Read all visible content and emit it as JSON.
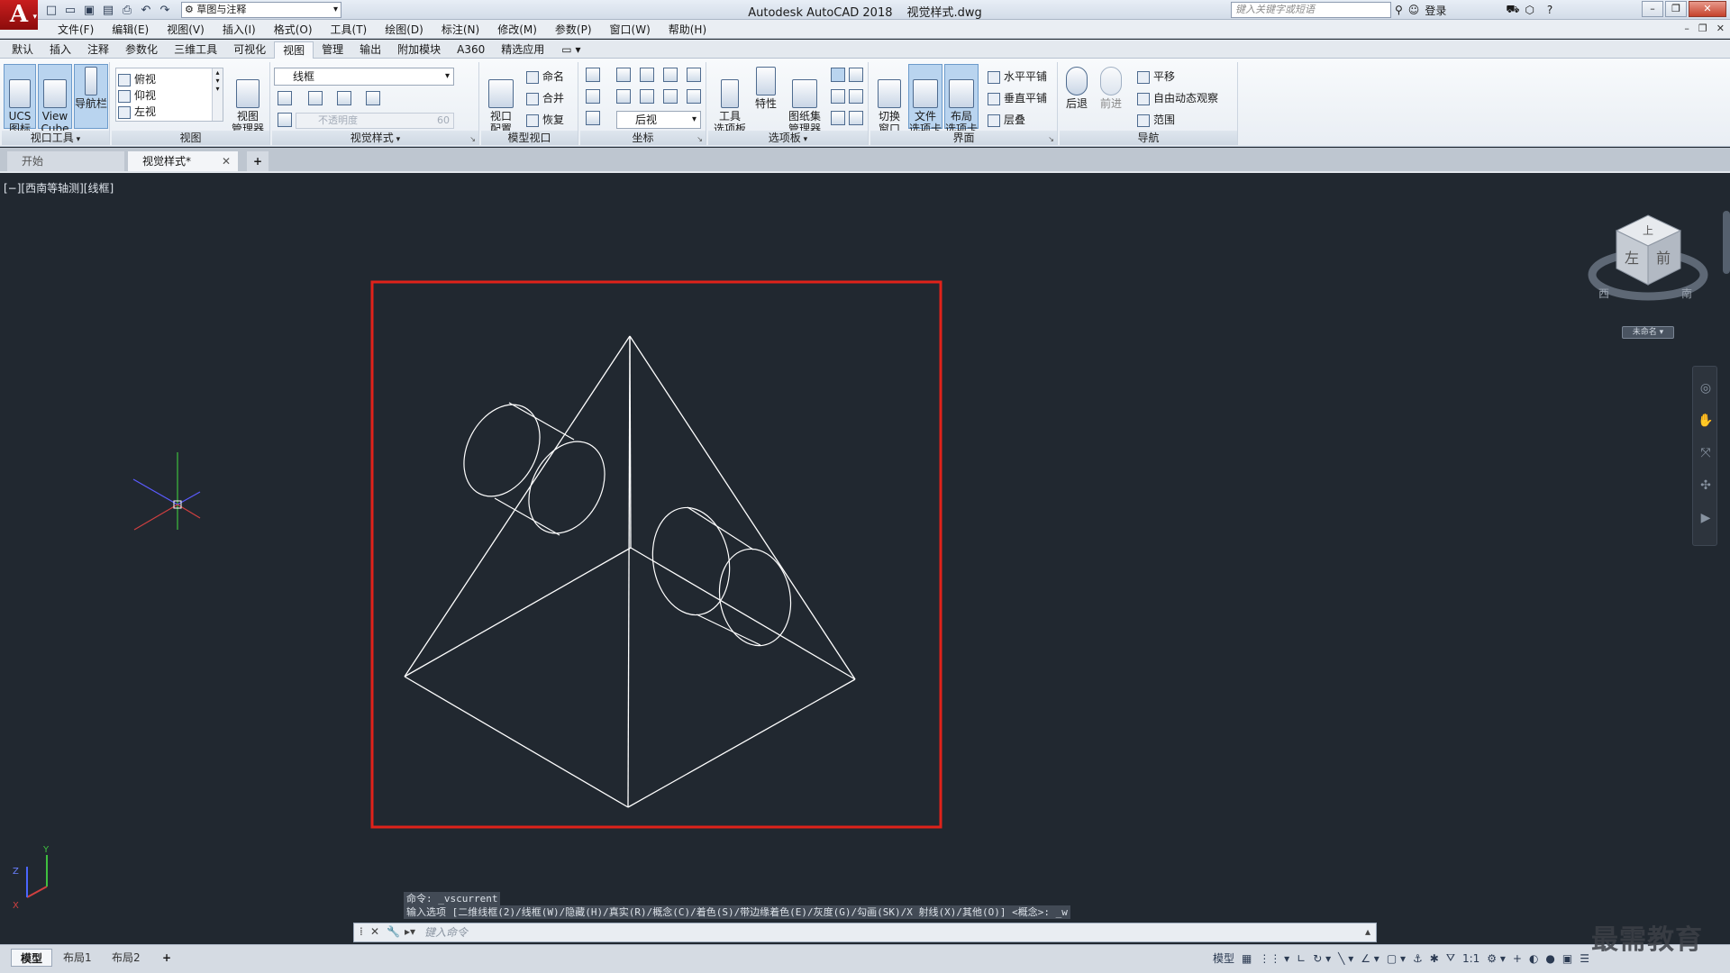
{
  "title_bar": {
    "logo": "A",
    "workspace": "草图与注释",
    "app_name": "Autodesk AutoCAD 2018",
    "file_name": "视觉样式.dwg",
    "search_placeholder": "键入关键字或短语",
    "login": "登录"
  },
  "menu": [
    "文件(F)",
    "编辑(E)",
    "视图(V)",
    "插入(I)",
    "格式(O)",
    "工具(T)",
    "绘图(D)",
    "标注(N)",
    "修改(M)",
    "参数(P)",
    "窗口(W)",
    "帮助(H)"
  ],
  "ribbon_tabs": [
    "默认",
    "插入",
    "注释",
    "参数化",
    "三维工具",
    "可视化",
    "视图",
    "管理",
    "输出",
    "附加模块",
    "A360",
    "精选应用"
  ],
  "active_ribbon_tab": "视图",
  "panels": {
    "viewport_tools": {
      "title": "视口工具",
      "ucs": "UCS\n图标",
      "viewcube": "View\nCube",
      "navbar": "导航栏"
    },
    "views": {
      "title": "视图",
      "items": [
        "俯视",
        "仰视",
        "左视"
      ],
      "manager": "视图\n管理器"
    },
    "visual_styles": {
      "title": "视觉样式",
      "current": "线框",
      "opacity_placeholder": "不透明度",
      "opacity_value": "60"
    },
    "model_viewports": {
      "title": "模型视口",
      "config": "视口\n配置",
      "name": "命名",
      "join": "合并",
      "restore": "恢复"
    },
    "coordinates": {
      "title": "坐标",
      "view": "后视"
    },
    "palettes": {
      "title": "选项板",
      "tool": "工具\n选项板",
      "properties": "特性",
      "sheetset": "图纸集\n管理器"
    },
    "interface": {
      "title": "界面",
      "switch": "切换\n窗口",
      "file_tabs": "文件\n选项卡",
      "layout_tabs": "布局\n选项卡",
      "tile_h": "水平平铺",
      "tile_v": "垂直平铺",
      "cascade": "层叠"
    },
    "navigate": {
      "title": "导航",
      "back": "后退",
      "forward": "前进",
      "pan": "平移",
      "orbit": "自由动态观察",
      "extents": "范围"
    }
  },
  "file_tabs": {
    "start": "开始",
    "doc": "视觉样式*"
  },
  "viewport_label": "[−][西南等轴测][线框]",
  "viewcube": {
    "top": "上",
    "left": "左",
    "front": "前",
    "west": "西",
    "south": "南",
    "name": "未命名"
  },
  "command": {
    "history1": "命令: _vscurrent",
    "history2": "输入选项 [二维线框(2)/线框(W)/隐藏(H)/真实(R)/概念(C)/着色(S)/带边缘着色(E)/灰度(G)/勾画(SK)/X 射线(X)/其他(O)] <概念>: _w",
    "placeholder": "键入命令"
  },
  "layout_tabs": [
    "模型",
    "布局1",
    "布局2"
  ],
  "status": {
    "model": "模型",
    "scale": "1:1"
  },
  "watermark": "最需教育",
  "colors": {
    "canvas": "#212830",
    "highlight": "#e0221a",
    "wire": "#ffffff"
  }
}
